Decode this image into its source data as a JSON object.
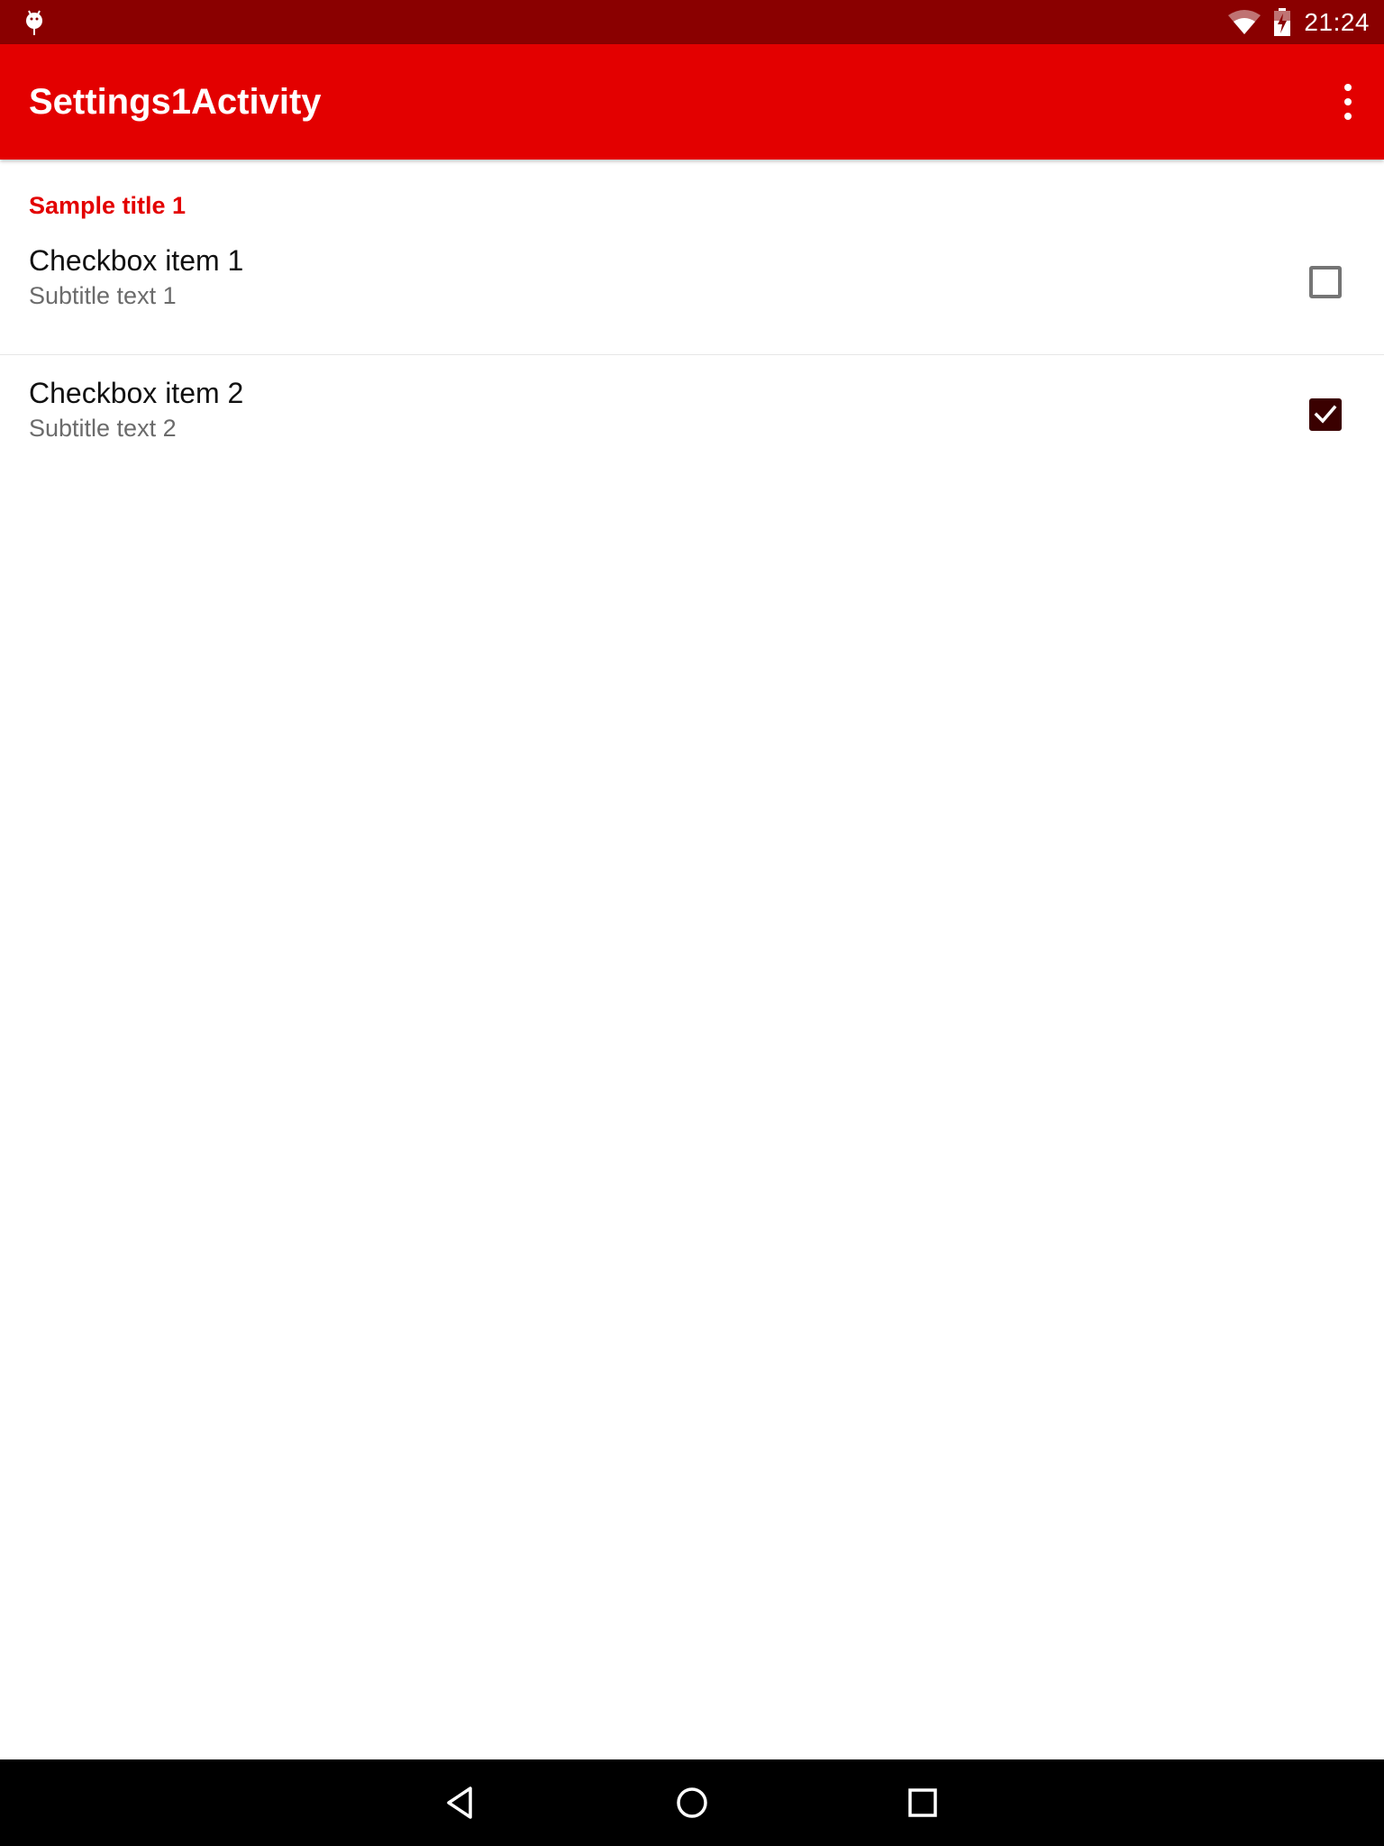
{
  "status_bar": {
    "time": "21:24",
    "notification_icon": "android-debug-icon",
    "wifi_icon": "wifi-icon",
    "battery_icon": "battery-charging-icon",
    "background": "#8a0000"
  },
  "app_bar": {
    "title": "Settings1Activity",
    "menu_icon": "overflow-menu-icon",
    "background": "#e30000"
  },
  "preferences": {
    "category_title": "Sample title 1",
    "category_color": "#e30000",
    "items": [
      {
        "title": "Checkbox item 1",
        "summary": "Subtitle text 1",
        "checked": false
      },
      {
        "title": "Checkbox item 2",
        "summary": "Subtitle text 2",
        "checked": true
      }
    ]
  },
  "nav_bar": {
    "buttons": [
      "back-icon",
      "home-icon",
      "recents-icon"
    ]
  }
}
